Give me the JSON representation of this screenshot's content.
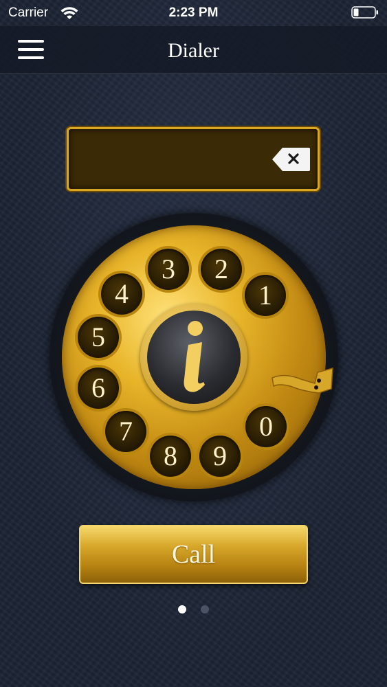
{
  "status_bar": {
    "carrier": "Carrier",
    "time": "2:23 PM",
    "wifi_icon": "wifi-icon",
    "battery_icon": "battery-icon"
  },
  "nav": {
    "title": "Dialer",
    "menu_icon": "hamburger-menu-icon"
  },
  "display": {
    "value": "",
    "backspace_icon": "backspace-icon"
  },
  "dial": {
    "keys": [
      "1",
      "2",
      "3",
      "4",
      "5",
      "6",
      "7",
      "8",
      "9",
      "0"
    ],
    "center_icon": "info-icon"
  },
  "call_button": {
    "label": "Call"
  },
  "pager": {
    "pages": 2,
    "current": 1
  },
  "colors": {
    "gold": "#d8a825",
    "background": "#1c2434",
    "hole": "#271c04"
  }
}
